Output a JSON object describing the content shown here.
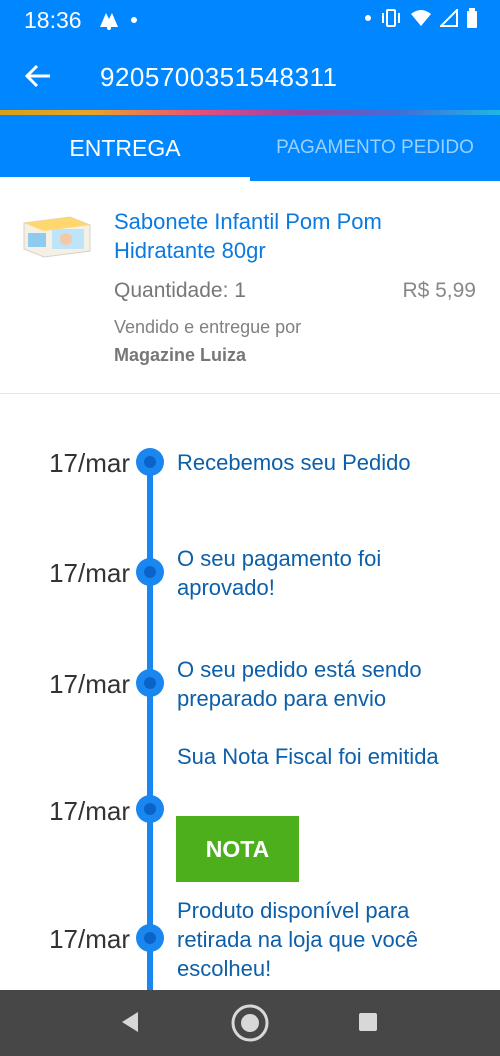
{
  "status_bar": {
    "time": "18:36",
    "left_icons": [
      "notification-icon",
      "dot-icon"
    ],
    "right_icons": [
      "dot-icon",
      "vibrate-icon",
      "wifi-icon",
      "signal-icon",
      "battery-icon"
    ]
  },
  "app_bar": {
    "order_number": "9205700351548311",
    "back_icon": "arrow-back-icon"
  },
  "tabs": [
    {
      "label": "ENTREGA",
      "active": true
    },
    {
      "label": "PAGAMENTO PEDIDO",
      "active": false
    }
  ],
  "product": {
    "name": "Sabonete Infantil Pom Pom Hidratante 80gr",
    "quantity": "Quantidade: 1",
    "price": "R$ 5,99",
    "sold_by_label": "Vendido e entregue por",
    "seller": "Magazine Luiza"
  },
  "timeline": [
    {
      "date": "17/mar",
      "text": "Recebemos seu Pedido"
    },
    {
      "date": "17/mar",
      "text": "O seu pagamento foi aprovado!"
    },
    {
      "date": "17/mar",
      "text": "O seu pedido está sendo preparado para envio"
    },
    {
      "date": "17/mar",
      "text": "Sua Nota Fiscal foi emitida",
      "button": "NOTA"
    },
    {
      "date": "17/mar",
      "text": "Produto disponível para retirada na loja que você escolheu!"
    }
  ],
  "colors": {
    "primary": "#0086ff",
    "timeline": "#1a87f0",
    "link": "#0b7ae0",
    "button_green": "#4caf1b",
    "nav_bar": "#474747"
  },
  "nav_bar": {
    "buttons": [
      "back-triangle-icon",
      "home-circle-icon",
      "recents-square-icon"
    ]
  }
}
